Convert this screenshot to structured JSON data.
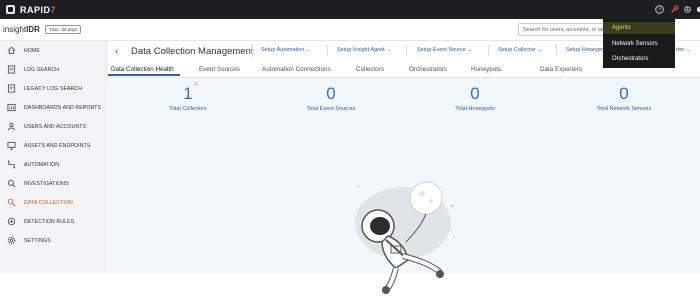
{
  "topbar": {
    "logo_main": "RAPID",
    "logo_accent": "7",
    "icons": [
      "help-icon",
      "settings-icon",
      "gear-icon"
    ]
  },
  "dropdown": {
    "items": [
      {
        "label": "Agents",
        "active": true
      },
      {
        "label": "Network Sensors",
        "active": false
      },
      {
        "label": "Orchestrators",
        "active": false
      }
    ]
  },
  "brand": {
    "prefix": "insight",
    "suffix": "IDR",
    "trial": "Trial - 28 days"
  },
  "search": {
    "placeholder": "Search for users, accounts, or as"
  },
  "sidebar": {
    "items": [
      {
        "label": "HOME",
        "icon": "home-icon"
      },
      {
        "label": "LOG SEARCH",
        "icon": "log-search-icon"
      },
      {
        "label": "LEGACY LOG SEARCH",
        "icon": "legacy-log-search-icon"
      },
      {
        "label": "DASHBOARDS AND REPORTS",
        "icon": "dashboard-icon"
      },
      {
        "label": "USERS AND ACCOUNTS",
        "icon": "users-icon"
      },
      {
        "label": "ASSETS AND ENDPOINTS",
        "icon": "monitor-icon"
      },
      {
        "label": "AUTOMATION",
        "icon": "automation-icon"
      },
      {
        "label": "INVESTIGATIONS",
        "icon": "investigations-icon"
      },
      {
        "label": "DATA COLLECTION",
        "icon": "data-collection-icon",
        "active": true
      },
      {
        "label": "DETECTION RULES",
        "icon": "detection-rules-icon"
      },
      {
        "label": "SETTINGS",
        "icon": "settings-icon"
      }
    ]
  },
  "main": {
    "back": "‹",
    "title": "Data Collection Management",
    "setup_links": [
      "Setup Automation",
      "Setup Insight Agent",
      "Setup Event Source",
      "Setup Collector",
      "Setup Honeypo",
      "rter"
    ],
    "tabs": [
      "Data Collection Health",
      "Event Sources",
      "Automation Connections",
      "Collectors",
      "Orchestrators",
      "Honeypots",
      "Data Exporters"
    ],
    "stats": [
      {
        "value": "1",
        "label": "Total Collectors",
        "warning": true
      },
      {
        "value": "0",
        "label": "Total Event Sources",
        "warning": false
      },
      {
        "value": "0",
        "label": "Total Honeypots",
        "warning": false
      },
      {
        "value": "0",
        "label": "Total Network Sensors",
        "warning": false
      }
    ]
  },
  "colors": {
    "accent": "#d9541e",
    "link": "#2c5fa8",
    "stat": "#2f6fc2",
    "topbar": "#1c1e22"
  }
}
